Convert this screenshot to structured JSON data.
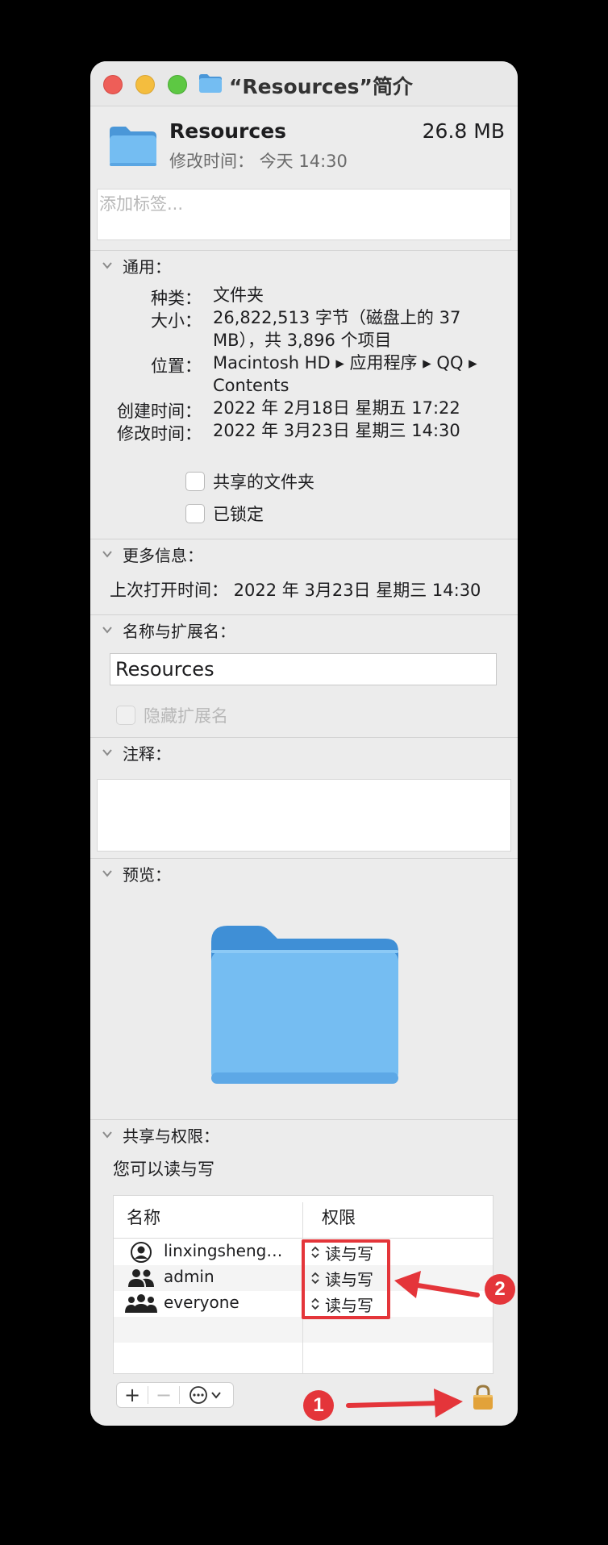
{
  "window": {
    "title": "“Resources”简介"
  },
  "summary": {
    "name": "Resources",
    "size": "26.8 MB",
    "modified": "修改时间：  今天 14:30"
  },
  "tags": {
    "placeholder": "添加标签..."
  },
  "general": {
    "title": "通用：",
    "rows": [
      {
        "label": "种类：",
        "value": "文件夹"
      },
      {
        "label": "大小：",
        "value": "26,822,513 字节（磁盘上的 37 MB），共 3,896 个项目"
      },
      {
        "label": "位置：",
        "value": "Macintosh HD ▸ 应用程序 ▸ QQ ▸ Contents"
      },
      {
        "label": "创建时间：",
        "value": "2022 年 2月18日 星期五 17:22"
      },
      {
        "label": "修改时间：",
        "value": "2022 年 3月23日 星期三 14:30"
      }
    ],
    "shared_folder_label": "共享的文件夹",
    "locked_label": "已锁定"
  },
  "more_info": {
    "title": "更多信息：",
    "last_opened": "上次打开时间：  2022 年 3月23日 星期三 14:30"
  },
  "name_ext": {
    "title": "名称与扩展名：",
    "value": "Resources",
    "hide_ext_label": "隐藏扩展名"
  },
  "comments": {
    "title": "注释："
  },
  "preview": {
    "title": "预览："
  },
  "sharing": {
    "title": "共享与权限：",
    "note": "您可以读与写",
    "col_name": "名称",
    "col_perm": "权限",
    "rows": [
      {
        "name": "linxingsheng…",
        "perm": "读与写",
        "icon": "user-icon"
      },
      {
        "name": "admin",
        "perm": "读与写",
        "icon": "group-icon"
      },
      {
        "name": "everyone",
        "perm": "读与写",
        "icon": "everyone-icon"
      }
    ]
  },
  "toolbar": {
    "add": "+",
    "remove": "−"
  },
  "annotations": {
    "marker_1": "1",
    "marker_2": "2",
    "color": "#e4353a"
  },
  "colors": {
    "folder_blue": "#6fb8ef",
    "folder_tab": "#4a97d8",
    "lock": "#e2a23a"
  }
}
